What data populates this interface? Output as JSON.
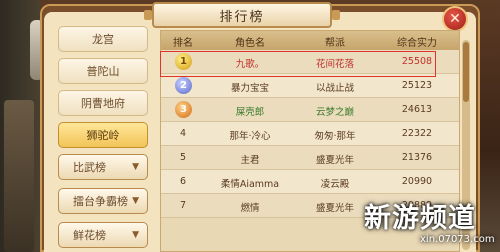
{
  "title": "排行榜",
  "close_icon": "✕",
  "sidebar": {
    "items": [
      {
        "label": "龙宫"
      },
      {
        "label": "普陀山"
      },
      {
        "label": "阴曹地府"
      },
      {
        "label": "狮驼岭"
      },
      {
        "label": "比武榜"
      },
      {
        "label": "擂台争霸榜"
      },
      {
        "label": "鲜花榜"
      }
    ],
    "active_index": 3
  },
  "table": {
    "headers": [
      "排名",
      "角色名",
      "帮派",
      "综合实力"
    ],
    "rows": [
      {
        "rank": "1",
        "name": "九歌。",
        "gang": "花间花落",
        "power": "25508"
      },
      {
        "rank": "2",
        "name": "暴力宝宝",
        "gang": "以战止战",
        "power": "25123"
      },
      {
        "rank": "3",
        "name": "屎壳郎",
        "gang": "云梦之巅",
        "power": "24613"
      },
      {
        "rank": "4",
        "name": "那年·冷心",
        "gang": "匆匆·那年",
        "power": "22322"
      },
      {
        "rank": "5",
        "name": "主君",
        "gang": "盛夏光年",
        "power": "21376"
      },
      {
        "rank": "6",
        "name": "柔情Aiamma",
        "gang": "凌云殿",
        "power": "20990"
      },
      {
        "rank": "7",
        "name": "燃情",
        "gang": "盛夏光年",
        "power": "20889"
      }
    ]
  },
  "watermark": {
    "main": "新游频道",
    "url": "xin.07073.com"
  },
  "colors": {
    "accent_red": "#e0352b",
    "active_tab": "#f2c457"
  }
}
